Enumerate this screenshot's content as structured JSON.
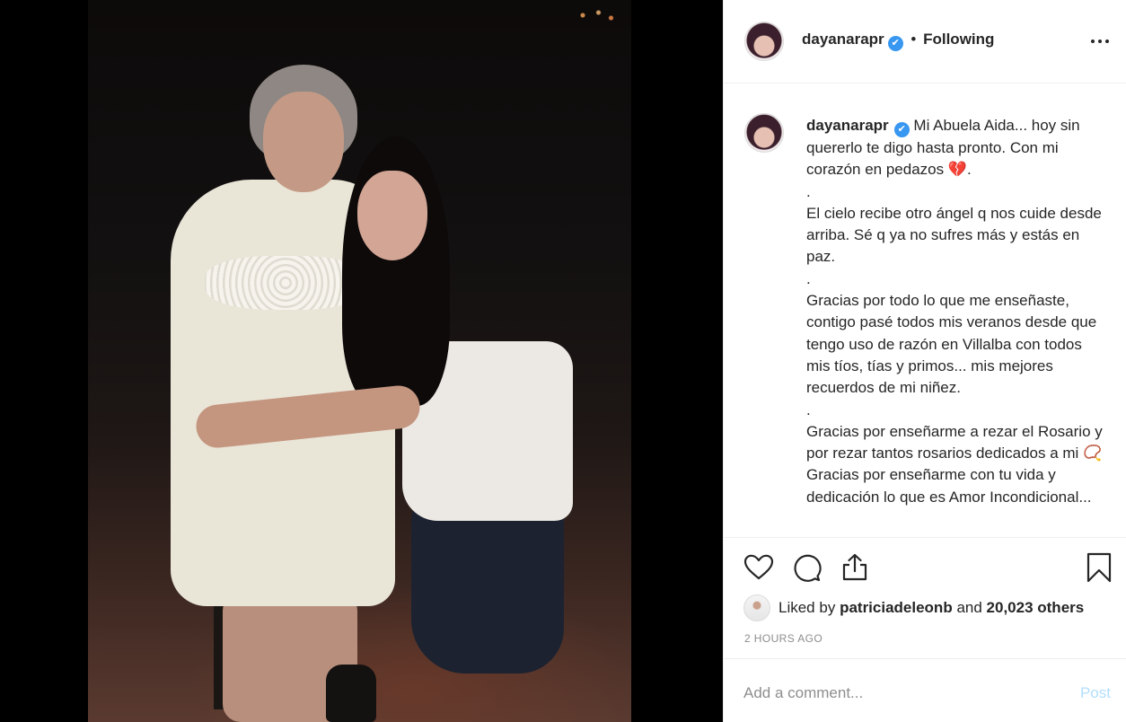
{
  "post": {
    "author": "dayanarapr",
    "verified_mark": "✔",
    "separator": "•",
    "follow_status": "Following",
    "more_icon": "ellipsis-icon",
    "caption_lines": [
      "Mi Abuela Aida... hoy sin quererlo te digo hasta pronto. Con mi corazón en pedazos 💔.",
      ".",
      "El cielo recibe otro ángel q nos cuide desde arriba. Sé q ya no sufres más y estás en paz.",
      ".",
      "Gracias por todo lo que me enseñaste, contigo pasé todos mis veranos desde que tengo uso de razón en Villalba con todos mis tíos, tías y primos... mis mejores recuerdos de mi niñez.",
      ".",
      "Gracias por enseñarme a rezar el Rosario y por rezar tantos rosarios dedicados a mi 📿Gracias por enseñarme con tu vida y dedicación lo que es Amor Incondicional..."
    ],
    "likes": {
      "prefix": "Liked by",
      "liker": "patriciadeleonb",
      "middle": "and",
      "count": "20,023 others"
    },
    "timestamp": "2 HOURS AGO",
    "comment_placeholder": "Add a comment...",
    "post_label": "Post"
  },
  "colors": {
    "verified": "#3897f0",
    "post_disabled": "#b2dffc",
    "text": "#262626",
    "muted": "#8e8e8e",
    "border": "#efefef"
  },
  "icons": {
    "like": "heart-outline-icon",
    "comment": "comment-bubble-icon",
    "share": "share-upload-icon",
    "save": "bookmark-icon"
  }
}
